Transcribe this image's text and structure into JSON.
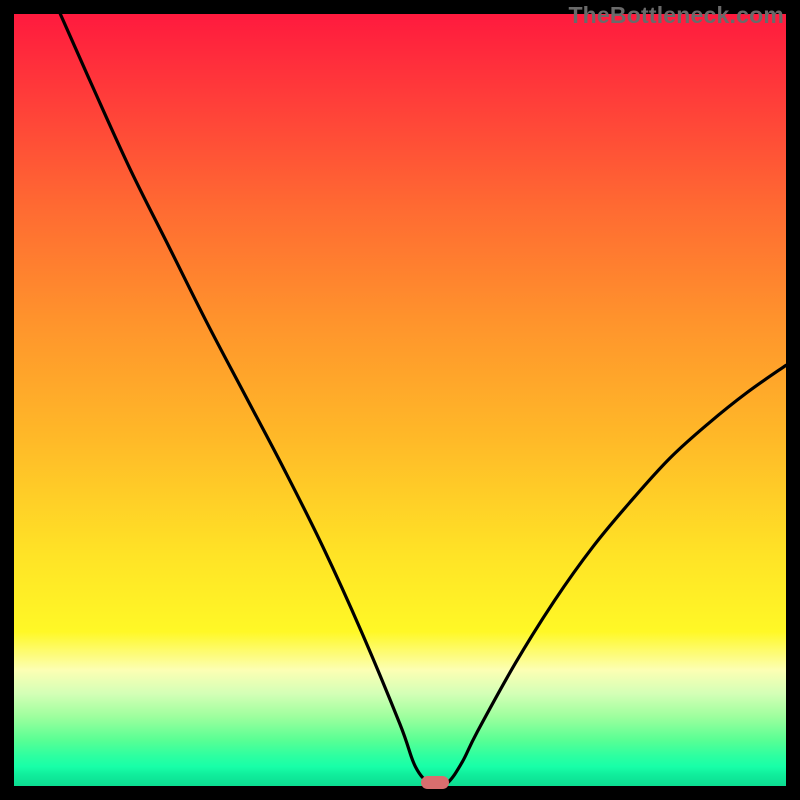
{
  "watermark": "TheBottleneck.com",
  "colors": {
    "frame": "#000000",
    "curve": "#000000",
    "marker": "#d86e6e",
    "watermark": "#6a6a6a"
  },
  "chart_data": {
    "type": "line",
    "title": "",
    "xlabel": "",
    "ylabel": "",
    "xlim": [
      0,
      100
    ],
    "ylim": [
      0,
      100
    ],
    "grid": false,
    "legend": false,
    "annotations": [],
    "marker": {
      "x": 54.5,
      "y": 0.5
    },
    "series": [
      {
        "name": "bottleneck-curve",
        "x": [
          6,
          10,
          15,
          20,
          25,
          30,
          35,
          40,
          45,
          50,
          52,
          54,
          56,
          58,
          60,
          65,
          70,
          75,
          80,
          85,
          90,
          95,
          100
        ],
        "y": [
          100,
          91,
          80,
          70,
          60,
          50.5,
          41,
          31,
          20,
          8,
          2.5,
          0.3,
          0.3,
          3,
          7,
          16,
          24,
          31,
          37,
          42.5,
          47,
          51,
          54.5
        ]
      }
    ]
  }
}
